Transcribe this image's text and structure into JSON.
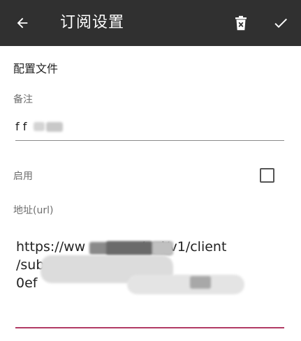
{
  "appbar": {
    "back_icon": "arrow-back-icon",
    "title": "订阅设置",
    "delete_icon": "delete-icon",
    "confirm_icon": "check-icon"
  },
  "section": {
    "title": "配置文件"
  },
  "remark": {
    "label": "备注",
    "value": "f   f"
  },
  "enable": {
    "label": "启用",
    "checked": false
  },
  "url": {
    "label": "地址(url)",
    "line1": "https://ww             /api/v1/client",
    "line2": "/subscribe?token=",
    "line3": "0ef                                         34"
  },
  "colors": {
    "appbar": "#303030",
    "accent_underline": "#b13a64"
  }
}
